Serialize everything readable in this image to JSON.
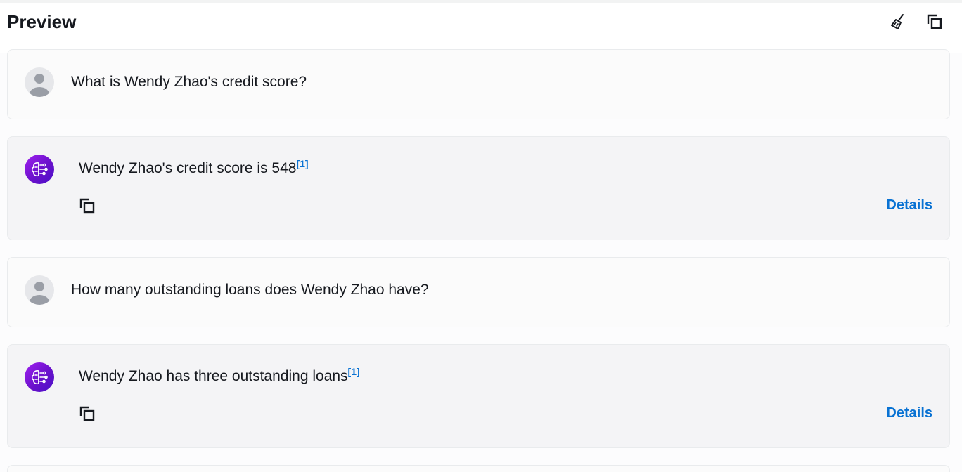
{
  "header": {
    "title": "Preview",
    "clear_icon": "broom-icon",
    "copy_icon": "copy-icon"
  },
  "conversation": [
    {
      "role": "user",
      "text": "What is Wendy Zhao's credit score?"
    },
    {
      "role": "assistant",
      "text": "Wendy Zhao's credit score is 548",
      "citation": "[1]",
      "details_label": "Details"
    },
    {
      "role": "user",
      "text": "How many outstanding loans does Wendy Zhao have?"
    },
    {
      "role": "assistant",
      "text": "Wendy Zhao has three outstanding loans",
      "citation": "[1]",
      "details_label": "Details"
    }
  ],
  "colors": {
    "link": "#0972d3",
    "bot_avatar_gradient_start": "#a020f0",
    "bot_avatar_gradient_end": "#4a10c8"
  }
}
